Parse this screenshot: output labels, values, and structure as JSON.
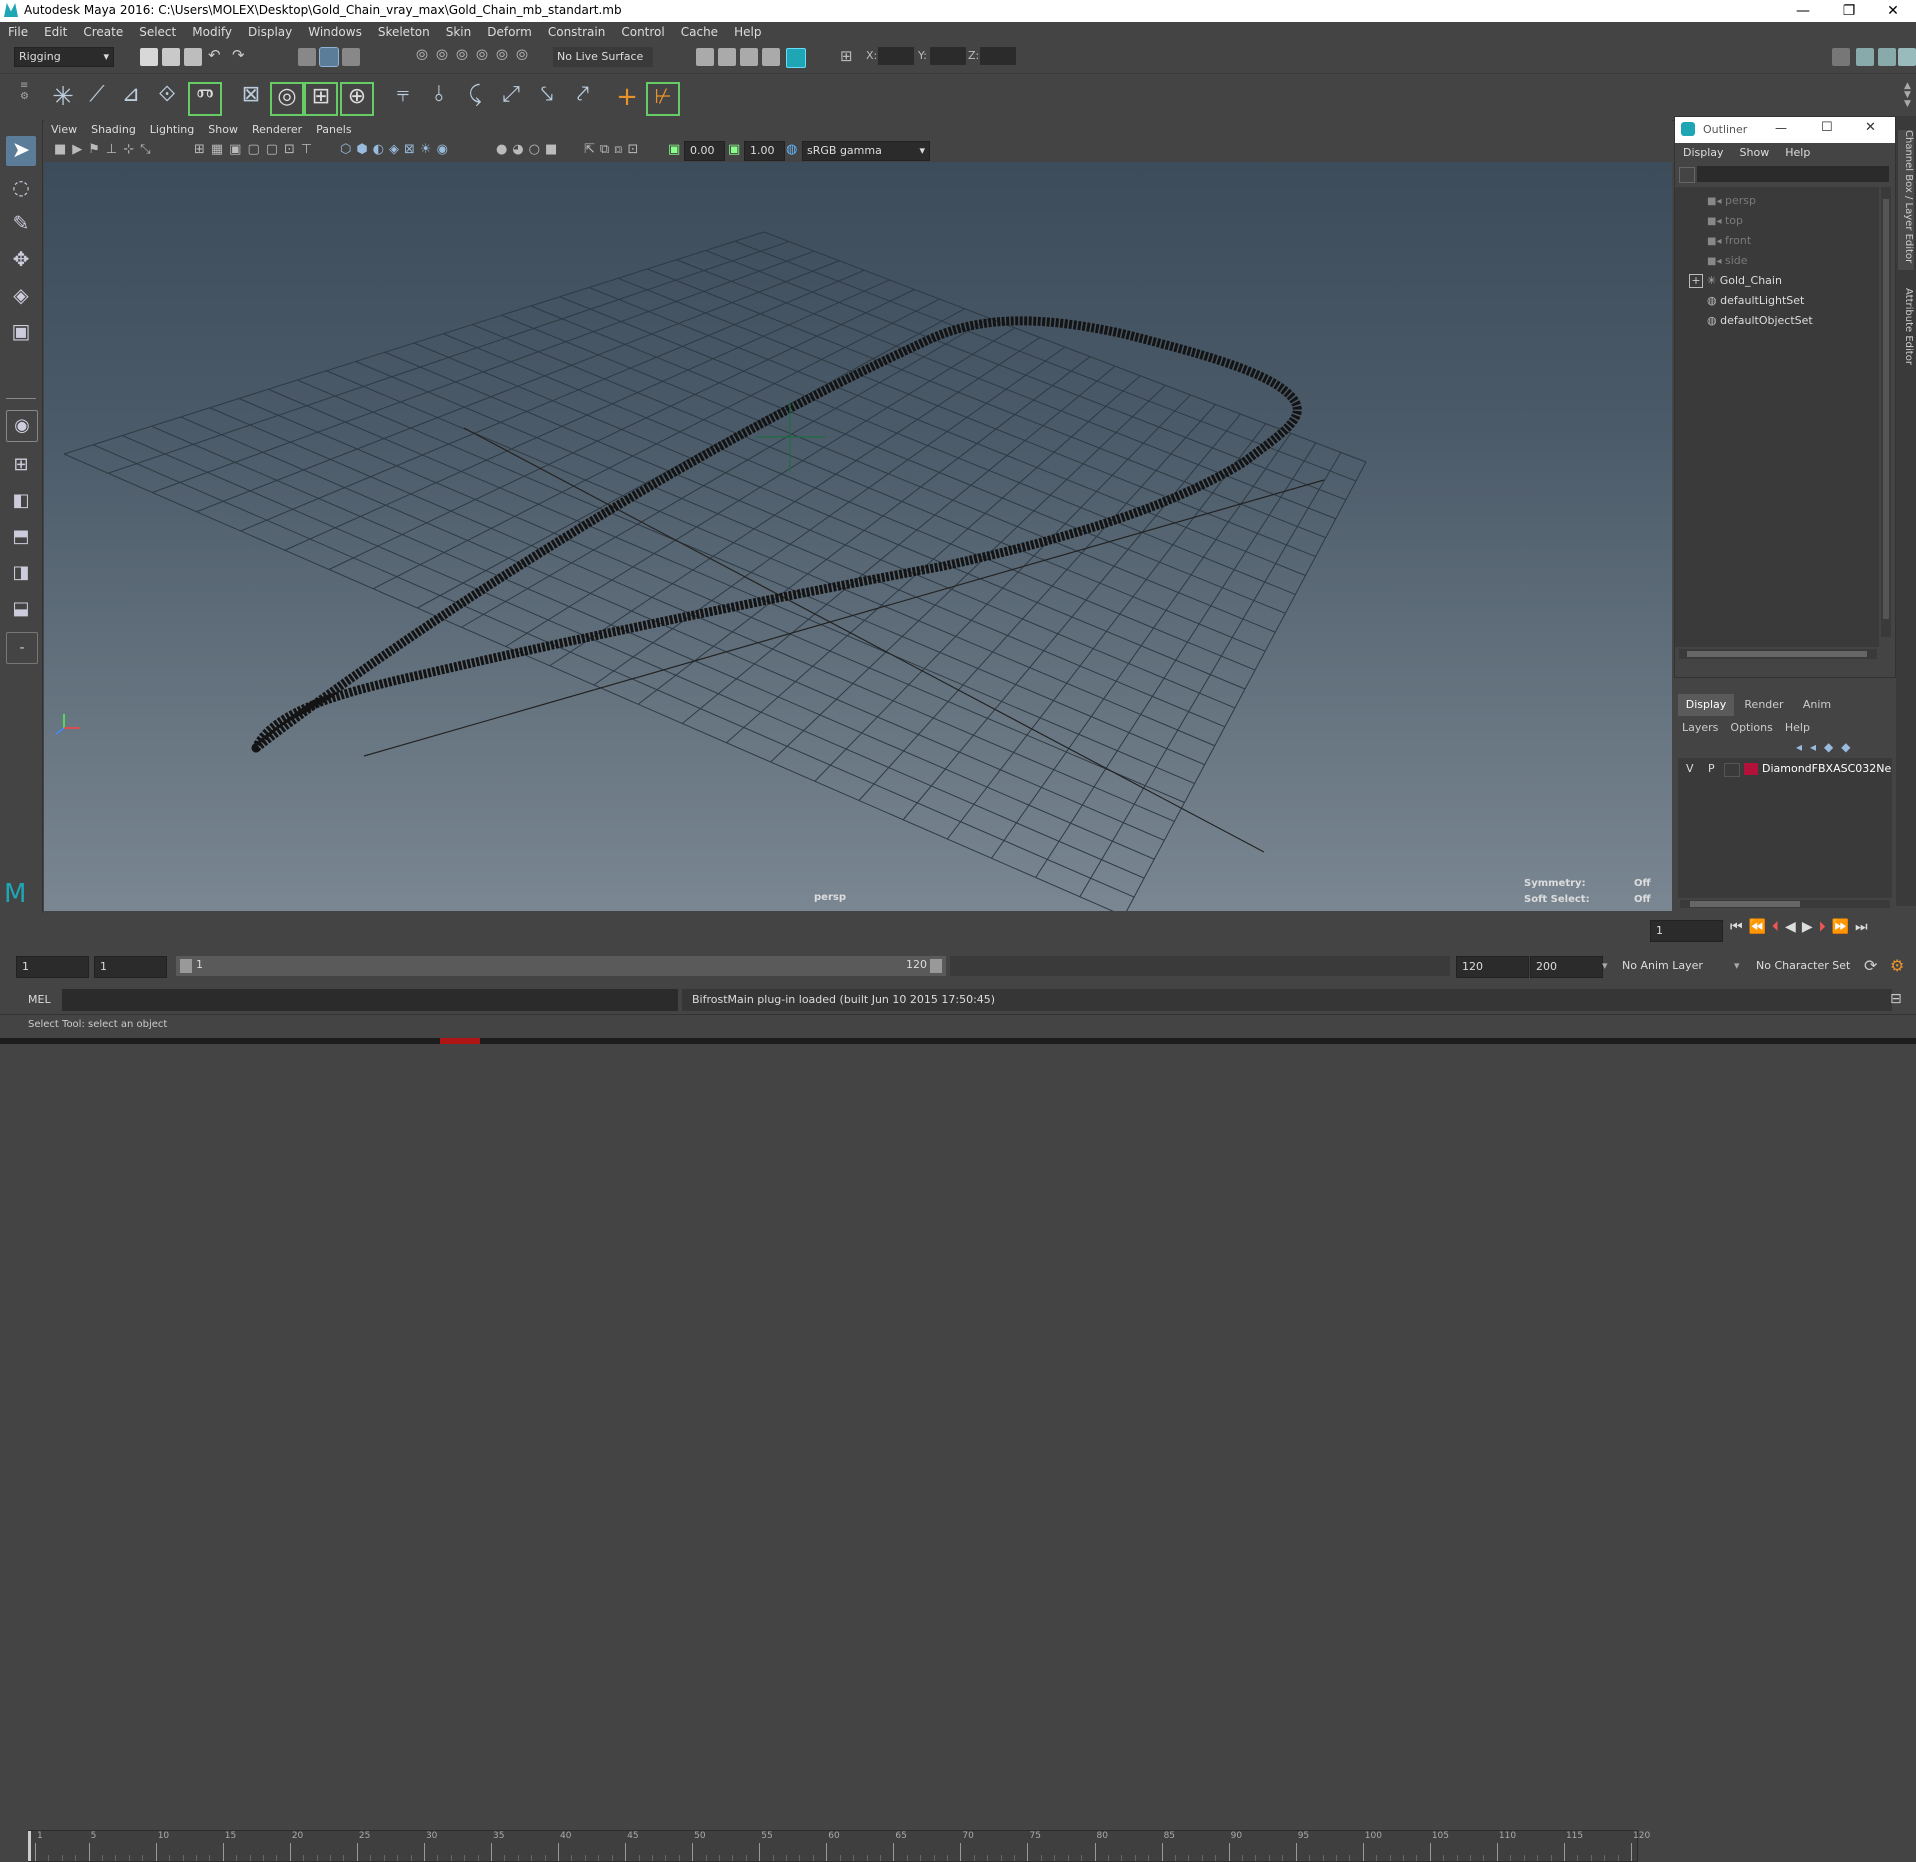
{
  "window": {
    "title": "Autodesk Maya 2016: C:\\Users\\MOLEX\\Desktop\\Gold_Chain_vray_max\\Gold_Chain_mb_standart.mb",
    "minimize": "—",
    "maximize": "❐",
    "close": "✕"
  },
  "menubar": [
    "File",
    "Edit",
    "Create",
    "Select",
    "Modify",
    "Display",
    "Windows",
    "Skeleton",
    "Skin",
    "Deform",
    "Constrain",
    "Control",
    "Cache",
    "Help"
  ],
  "statusline": {
    "menuset": "Rigging",
    "live_surface": "No Live Surface",
    "x_label": "X:",
    "y_label": "Y:",
    "z_label": "Z:"
  },
  "panel": {
    "menus": [
      "View",
      "Shading",
      "Lighting",
      "Show",
      "Renderer",
      "Panels"
    ],
    "exposure": "0.00",
    "gamma": "1.00",
    "colorspace": "sRGB gamma",
    "camera_label": "persp",
    "symmetry_label": "Symmetry:",
    "symmetry_value": "Off",
    "soft_select_label": "Soft Select:",
    "soft_select_value": "Off"
  },
  "outliner": {
    "title": "Outliner",
    "menus": [
      "Display",
      "Show",
      "Help"
    ],
    "items": [
      {
        "label": "persp",
        "icon": "camera-icon",
        "dim": true,
        "expand": false
      },
      {
        "label": "top",
        "icon": "camera-icon",
        "dim": true,
        "expand": false
      },
      {
        "label": "front",
        "icon": "camera-icon",
        "dim": true,
        "expand": false
      },
      {
        "label": "side",
        "icon": "camera-icon",
        "dim": true,
        "expand": false
      },
      {
        "label": "Gold_Chain",
        "icon": "group-icon",
        "dim": false,
        "expand": true
      },
      {
        "label": "defaultLightSet",
        "icon": "set-icon",
        "dim": false,
        "expand": false
      },
      {
        "label": "defaultObjectSet",
        "icon": "set-icon",
        "dim": false,
        "expand": false
      }
    ]
  },
  "layer_editor": {
    "tabs": [
      "Display",
      "Render",
      "Anim"
    ],
    "active_tab": "Display",
    "menus": [
      "Layers",
      "Options",
      "Help"
    ],
    "layer": {
      "v": "V",
      "p": "P",
      "name": "DiamondFBXASC032Ne",
      "color": "#b0123a"
    }
  },
  "side_tabs": [
    "Channel Box / Layer Editor",
    "Attribute Editor"
  ],
  "time_slider": {
    "ticks": [
      "1",
      "5",
      "10",
      "15",
      "20",
      "25",
      "30",
      "35",
      "40",
      "45",
      "50",
      "55",
      "60",
      "65",
      "70",
      "75",
      "80",
      "85",
      "90",
      "95",
      "100",
      "105",
      "110",
      "115",
      "120"
    ],
    "current_frame": "1"
  },
  "range_slider": {
    "start": "1",
    "playback_start": "1",
    "range_start_label": "1",
    "range_end_label": "120",
    "playback_end": "120",
    "end": "200",
    "anim_layer": "No Anim Layer",
    "character_set": "No Character Set"
  },
  "command_line": {
    "lang": "MEL",
    "feedback": "BifrostMain plug-in loaded (built Jun 10 2015 17:50:45)"
  },
  "help_line": "Select Tool: select an object"
}
